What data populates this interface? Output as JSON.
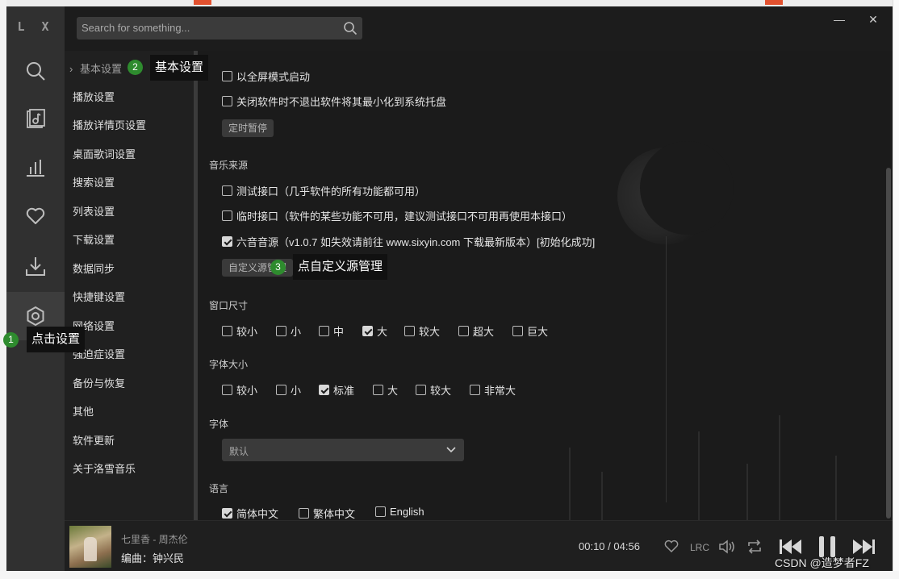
{
  "app": {
    "logo": "L X"
  },
  "search": {
    "placeholder": "Search for something..."
  },
  "window_controls": {
    "minimize": "—",
    "close": "✕"
  },
  "rail": [
    {
      "icon": "search-icon"
    },
    {
      "icon": "music-note-icon"
    },
    {
      "icon": "chart-icon"
    },
    {
      "icon": "heart-icon"
    },
    {
      "icon": "download-icon"
    },
    {
      "icon": "settings-icon",
      "active": true
    }
  ],
  "nav": {
    "items": [
      {
        "label": "基本设置",
        "active": true,
        "caret": "›"
      },
      {
        "label": "播放设置"
      },
      {
        "label": "播放详情页设置"
      },
      {
        "label": "桌面歌词设置"
      },
      {
        "label": "搜索设置"
      },
      {
        "label": "列表设置"
      },
      {
        "label": "下载设置"
      },
      {
        "label": "数据同步"
      },
      {
        "label": "快捷键设置"
      },
      {
        "label": "网络设置"
      },
      {
        "label": "强迫症设置"
      },
      {
        "label": "备份与恢复"
      },
      {
        "label": "其他"
      },
      {
        "label": "软件更新"
      },
      {
        "label": "关于洛雪音乐"
      }
    ]
  },
  "basic": {
    "fullscreen": {
      "label": "以全屏模式启动",
      "checked": false
    },
    "tray": {
      "label": "关闭软件时不退出软件将其最小化到系统托盘",
      "checked": false
    },
    "timer_button": "定时暂停"
  },
  "music_source": {
    "title": "音乐来源",
    "options": [
      {
        "label": "测试接口（几乎软件的所有功能都可用）",
        "checked": false
      },
      {
        "label": "临时接口（软件的某些功能不可用，建议测试接口不可用再使用本接口）",
        "checked": false
      },
      {
        "label": "六音音源（v1.0.7 如失效请前往 www.sixyin.com 下载最新版本）[初始化成功]",
        "checked": true
      }
    ],
    "custom_button": "自定义源管理"
  },
  "window_size": {
    "title": "窗口尺寸",
    "options": [
      {
        "label": "较小",
        "checked": false
      },
      {
        "label": "小",
        "checked": false
      },
      {
        "label": "中",
        "checked": false
      },
      {
        "label": "大",
        "checked": true
      },
      {
        "label": "较大",
        "checked": false
      },
      {
        "label": "超大",
        "checked": false
      },
      {
        "label": "巨大",
        "checked": false
      }
    ]
  },
  "font_size": {
    "title": "字体大小",
    "options": [
      {
        "label": "较小",
        "checked": false
      },
      {
        "label": "小",
        "checked": false
      },
      {
        "label": "标准",
        "checked": true
      },
      {
        "label": "大",
        "checked": false
      },
      {
        "label": "较大",
        "checked": false
      },
      {
        "label": "非常大",
        "checked": false
      }
    ]
  },
  "font": {
    "title": "字体",
    "selected": "默认"
  },
  "language": {
    "title": "语言",
    "options": [
      {
        "label": "简体中文",
        "checked": true
      },
      {
        "label": "繁体中文",
        "checked": false
      },
      {
        "label": "English",
        "checked": false
      }
    ]
  },
  "annotations": {
    "step1": {
      "num": "1",
      "text": "点击设置"
    },
    "step2": {
      "num": "2",
      "text": "基本设置"
    },
    "step3": {
      "num": "3",
      "text": "点自定义源管理"
    }
  },
  "player": {
    "song": "七里香 - 周杰伦",
    "lyric": "编曲：钟兴民",
    "current_time": "00:10",
    "separator": "/",
    "duration": "04:56",
    "lrc_label": "LRC"
  },
  "watermark": "CSDN @造梦者FZ",
  "colors": {
    "accent_green": "#2e8b2e",
    "background": "#1e1e1e"
  }
}
